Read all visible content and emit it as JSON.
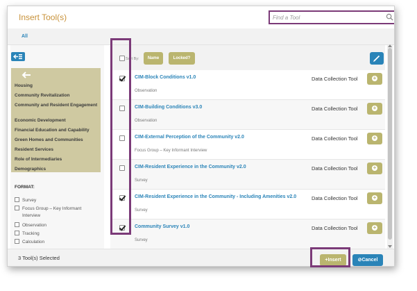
{
  "dialog": {
    "title": "Insert Tool(s)",
    "search": {
      "placeholder": "Find a Tool"
    }
  },
  "filter": {
    "all_label": "All"
  },
  "sidebar": {
    "categories": [
      "Housing",
      "Community Revitalization",
      "Community and Resident Engagement",
      "Economic Development",
      "Financial Education and Capability",
      "Green Homes and Communities",
      "Resident Services",
      "Role of Intermediaries",
      "Demographics"
    ],
    "format": {
      "title": "FORMAT:",
      "options": [
        {
          "label": "Survey",
          "checked": false
        },
        {
          "label": "Focus Group – Key Informant Interview",
          "checked": false
        },
        {
          "label": "Observation",
          "checked": false
        },
        {
          "label": "Tracking",
          "checked": false
        },
        {
          "label": "Calculation",
          "checked": false
        }
      ]
    }
  },
  "list": {
    "sort_by_label": "Sort By:",
    "sort_buttons": [
      "Name",
      "Locked?"
    ],
    "tools": [
      {
        "name": "CIM-Block Conditions v1.0",
        "type": "Observation",
        "category": "Data Collection Tool",
        "checked": true
      },
      {
        "name": "CIM-Building Conditions v3.0",
        "type": "Observation",
        "category": "Data Collection Tool",
        "checked": false
      },
      {
        "name": "CIM-External Perception of the Community v2.0",
        "type": "Focus Group – Key Informant Interview",
        "category": "Data Collection Tool",
        "checked": false
      },
      {
        "name": "CIM-Resident Experience in the Community v2.0",
        "type": "Survey",
        "category": "Data Collection Tool",
        "checked": false
      },
      {
        "name": "CIM-Resident Experience in the Community - Including Amenities v2.0",
        "type": "Survey",
        "category": "Data Collection Tool",
        "checked": true
      },
      {
        "name": "Community Survey v1.0",
        "type": "Survey",
        "category": "Data Collection Tool",
        "checked": true
      }
    ]
  },
  "footer": {
    "selected_text": "3 Tool(s) Selected",
    "insert_label": "Insert",
    "cancel_label": "Cancel"
  },
  "colors": {
    "accent_blue": "#2a84b8",
    "olive": "#bab56f",
    "title_orange": "#c8923a",
    "highlight_purple": "#7b3a78",
    "category_panel": "#cfc9a1"
  },
  "icons": [
    "search-icon",
    "collapse-sidebar-icon",
    "back-arrow-icon",
    "edit-icon",
    "add-icon",
    "plus-icon",
    "cancel-icon"
  ]
}
